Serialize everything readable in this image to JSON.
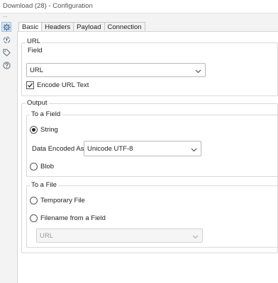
{
  "window": {
    "title": "Download (28) - Configuration",
    "overflow_glyph": "..."
  },
  "sidebar": {
    "icons": [
      {
        "name": "gear-icon",
        "active": true
      },
      {
        "name": "recycle-icon",
        "active": false
      },
      {
        "name": "tag-icon",
        "active": false
      },
      {
        "name": "help-icon",
        "active": false
      }
    ]
  },
  "tabs": [
    {
      "label": "Basic",
      "active": true
    },
    {
      "label": "Headers",
      "active": false
    },
    {
      "label": "Payload",
      "active": false
    },
    {
      "label": "Connection",
      "active": false
    }
  ],
  "url_section": {
    "legend": "URL",
    "field_label": "Field",
    "field_value": "URL",
    "encode_label": "Encode URL Text",
    "encode_checked": true
  },
  "output_section": {
    "legend": "Output",
    "to_field": {
      "legend": "To a Field",
      "string_label": "String",
      "string_selected": true,
      "encoded_as_label": "Data Encoded As",
      "encoded_as_value": "Unicode UTF-8",
      "blob_label": "Blob",
      "blob_selected": false
    },
    "to_file": {
      "legend": "To a File",
      "temp_label": "Temporary File",
      "temp_selected": false,
      "filename_label": "Filename from a Field",
      "filename_selected": false,
      "filename_field_value": "URL"
    }
  },
  "colors": {
    "accent_selected_icon": "#d6e6f7",
    "panel_bg": "#ffffff",
    "chrome_bg": "#f3f3f3"
  }
}
